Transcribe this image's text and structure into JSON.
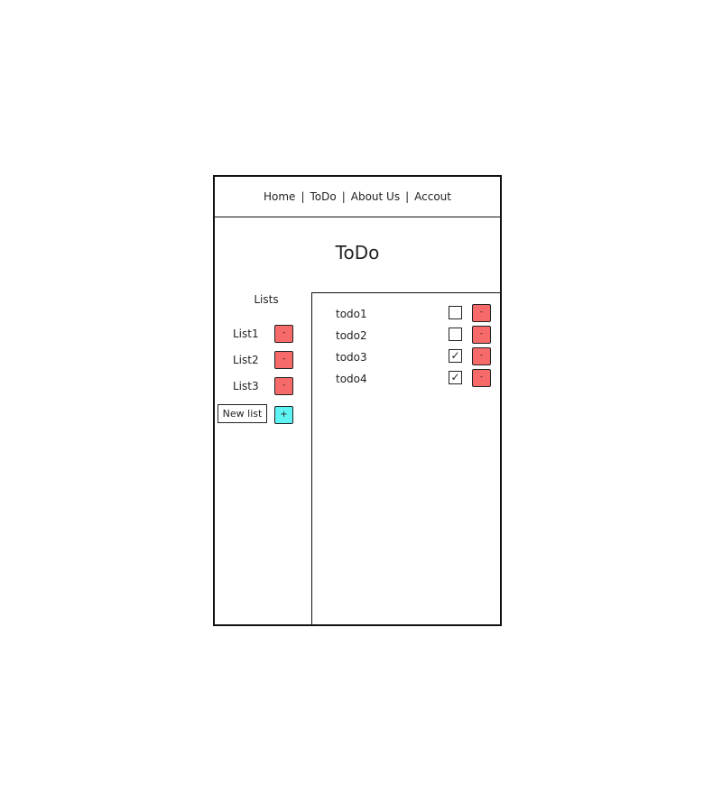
{
  "nav": {
    "items": [
      "Home",
      "ToDo",
      "About Us",
      "Accout"
    ],
    "separator": "|"
  },
  "page": {
    "title": "ToDo"
  },
  "lists": {
    "heading": "Lists",
    "items": [
      {
        "label": "List1",
        "remove_label": "-"
      },
      {
        "label": "List2",
        "remove_label": "-"
      },
      {
        "label": "List3",
        "remove_label": "-"
      }
    ],
    "new_list_placeholder": "New list",
    "add_label": "+"
  },
  "todos": {
    "items": [
      {
        "label": "todo1",
        "checked": false,
        "remove_label": "-"
      },
      {
        "label": "todo2",
        "checked": false,
        "remove_label": "-"
      },
      {
        "label": "todo3",
        "checked": true,
        "remove_label": "-"
      },
      {
        "label": "todo4",
        "checked": true,
        "remove_label": "-"
      }
    ]
  },
  "colors": {
    "remove": "#f76a6a",
    "add": "#5ff4f4",
    "border": "#111111"
  }
}
